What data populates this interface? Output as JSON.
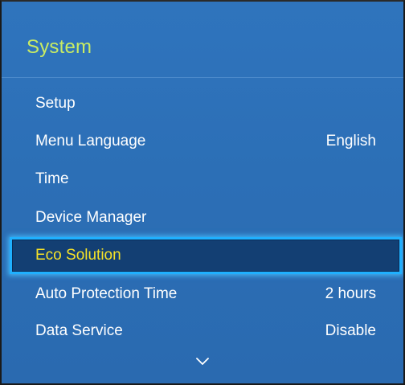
{
  "panel": {
    "title": "System",
    "scroll_icon": "chevron-down-icon"
  },
  "colors": {
    "panel_background": "#2c6fb6",
    "title_text": "#c9ec63",
    "selected_background": "#133f73",
    "selected_border": "#1fb0ff",
    "selected_text": "#f6e227",
    "item_text": "#ffffff"
  },
  "menu": {
    "items": [
      {
        "label": "Setup",
        "value": ""
      },
      {
        "label": "Menu Language",
        "value": "English"
      },
      {
        "label": "Time",
        "value": ""
      },
      {
        "label": "Device Manager",
        "value": ""
      },
      {
        "label": "Eco Solution",
        "value": "",
        "selected": true
      },
      {
        "label": "Auto Protection Time",
        "value": "2 hours"
      },
      {
        "label": "Data Service",
        "value": "Disable"
      }
    ]
  }
}
